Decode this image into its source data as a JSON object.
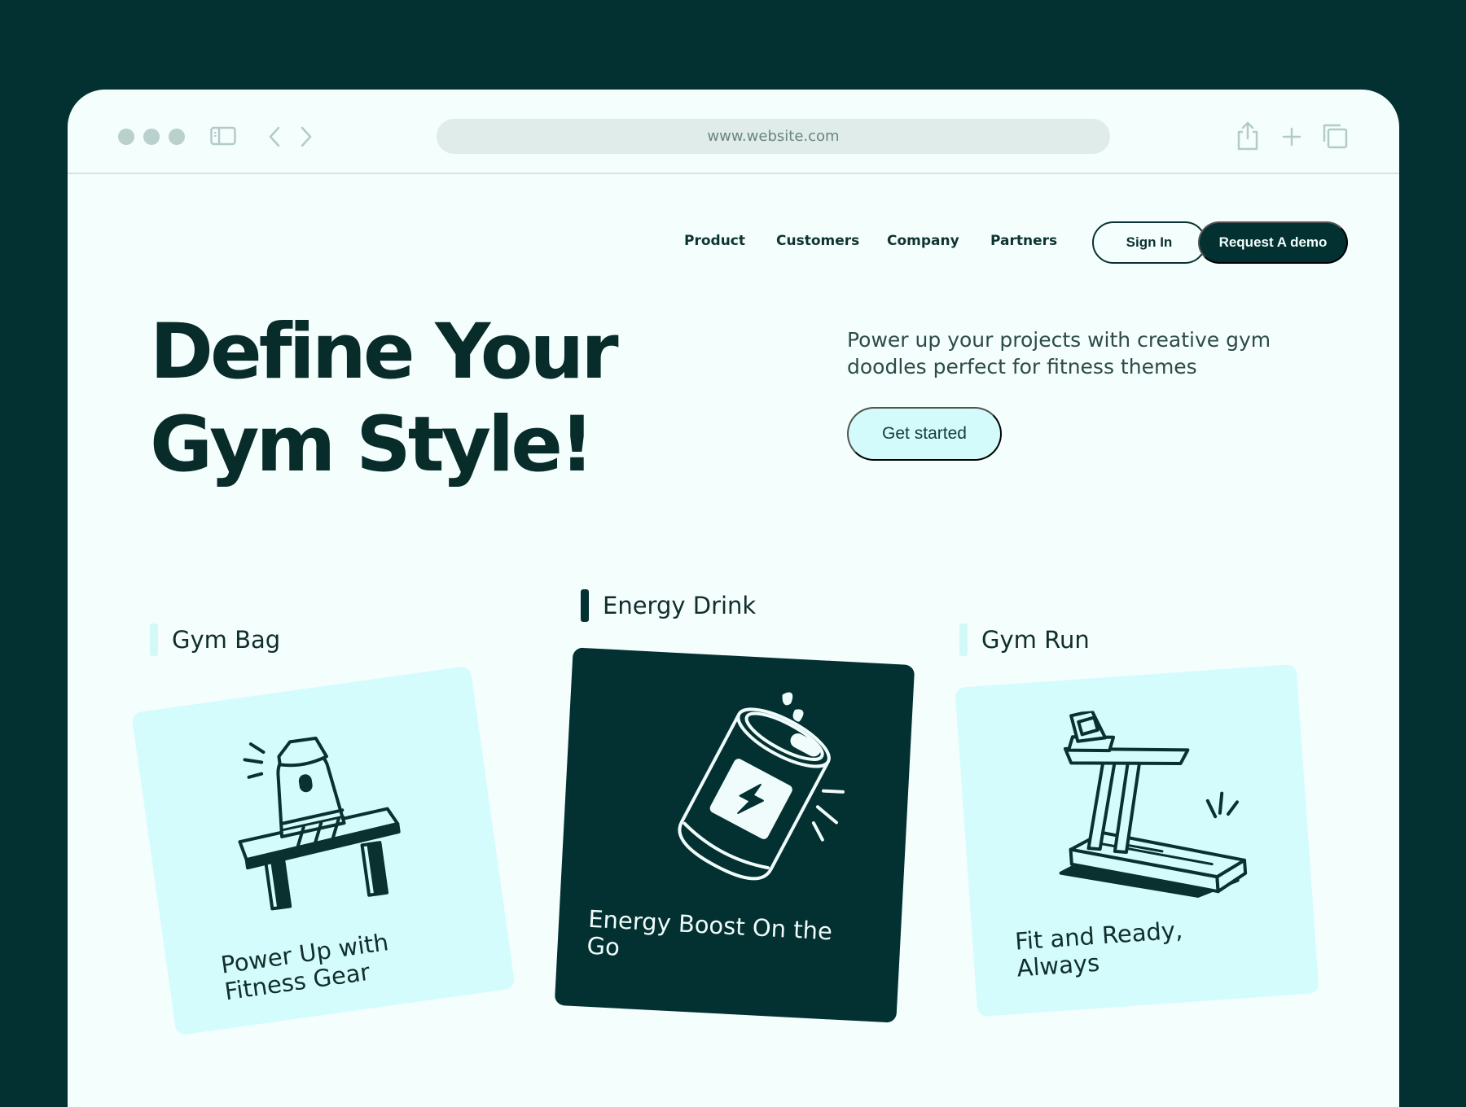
{
  "browser": {
    "url": "www.website.com",
    "icons": [
      "window-dot",
      "sidebar-icon",
      "back-chevron-icon",
      "forward-chevron-icon",
      "share-icon",
      "plus-icon",
      "tabs-icon"
    ]
  },
  "nav": {
    "links": [
      "Product",
      "Customers",
      "Company",
      "Partners"
    ],
    "sign_in": "Sign In",
    "request_demo": "Request A demo"
  },
  "hero": {
    "title_line1": "Define Your",
    "title_line2": "Gym Style!",
    "description": "Power up your projects with creative gym doodles perfect for fitness themes",
    "cta": "Get started"
  },
  "cards": [
    {
      "label": "Gym Bag",
      "text": "Power Up with Fitness Gear",
      "icon": "gym-bag-icon"
    },
    {
      "label": "Energy Drink",
      "text": "Energy Boost On the Go",
      "icon": "energy-drink-icon"
    },
    {
      "label": "Gym Run",
      "text": "Fit and Ready, Always",
      "icon": "treadmill-icon"
    }
  ],
  "colors": {
    "frame": "#033030",
    "page": "#f3fefd",
    "accent_light": "#d5fcfc",
    "ink": "#0b3030"
  }
}
